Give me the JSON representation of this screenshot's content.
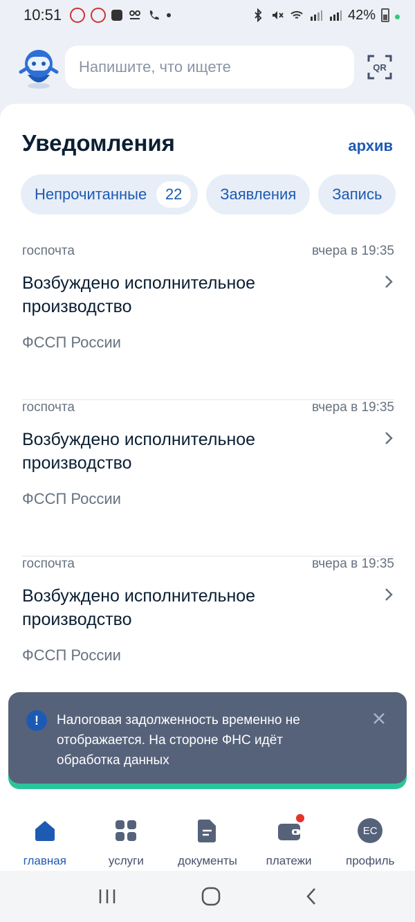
{
  "status_bar": {
    "time": "10:51",
    "battery": "42%"
  },
  "search": {
    "placeholder": "Напишите, что ищете"
  },
  "qr": {
    "label": "QR"
  },
  "page": {
    "title": "Уведомления",
    "archive": "архив"
  },
  "chips": [
    {
      "label": "Непрочитанные",
      "count": "22"
    },
    {
      "label": "Заявления"
    },
    {
      "label": "Запись"
    }
  ],
  "notifications": [
    {
      "source": "госпочта",
      "time": "вчера в 19:35",
      "title": "Возбуждено исполнительное производство",
      "org": "ФССП России"
    },
    {
      "source": "госпочта",
      "time": "вчера в 19:35",
      "title": "Возбуждено исполнительное производство",
      "org": "ФССП России"
    },
    {
      "source": "госпочта",
      "time": "вчера в 19:35",
      "title": "Возбуждено исполнительное производство",
      "org": "ФССП России"
    }
  ],
  "toast": {
    "icon": "!",
    "text": "Налоговая задолженность временно не отображается. На стороне ФНС идёт обработка данных"
  },
  "bottom_nav": [
    {
      "label": "главная",
      "icon": "home-icon"
    },
    {
      "label": "услуги",
      "icon": "grid-icon"
    },
    {
      "label": "документы",
      "icon": "document-icon"
    },
    {
      "label": "платежи",
      "icon": "wallet-icon"
    },
    {
      "label": "профиль",
      "icon": "avatar",
      "initials": "ЕС"
    }
  ],
  "colors": {
    "accent": "#1d5ab3",
    "toast_bg": "#56627a",
    "toast_bar": "#2bc59a"
  }
}
